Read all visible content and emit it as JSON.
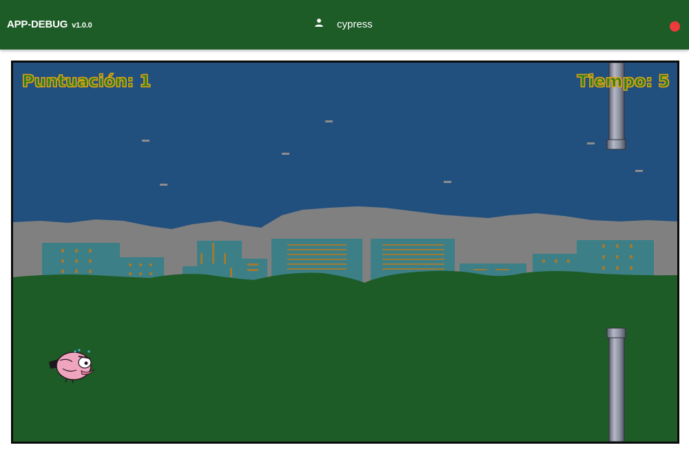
{
  "header": {
    "app_name": "APP-DEBUG",
    "version": "v1.0.0",
    "user": "cypress",
    "user_icon": "person-icon",
    "status_color": "#ef3b3b"
  },
  "game": {
    "score_label": "Puntuación:",
    "score": "1",
    "time_label": "Tiempo:",
    "time": "5",
    "colors": {
      "sky": "#22507e",
      "ground": "#1e5c27",
      "hills": "#808080",
      "buildings": "#3c7f86",
      "pipe": "#8a8f9e",
      "hud_fill": "#2f7d1c",
      "hud_outline": "#d8a01c"
    },
    "sprites": [
      "pink-bird",
      "top-pipe",
      "bottom-pipe",
      "city-skyline",
      "grey-hills",
      "stars"
    ]
  }
}
